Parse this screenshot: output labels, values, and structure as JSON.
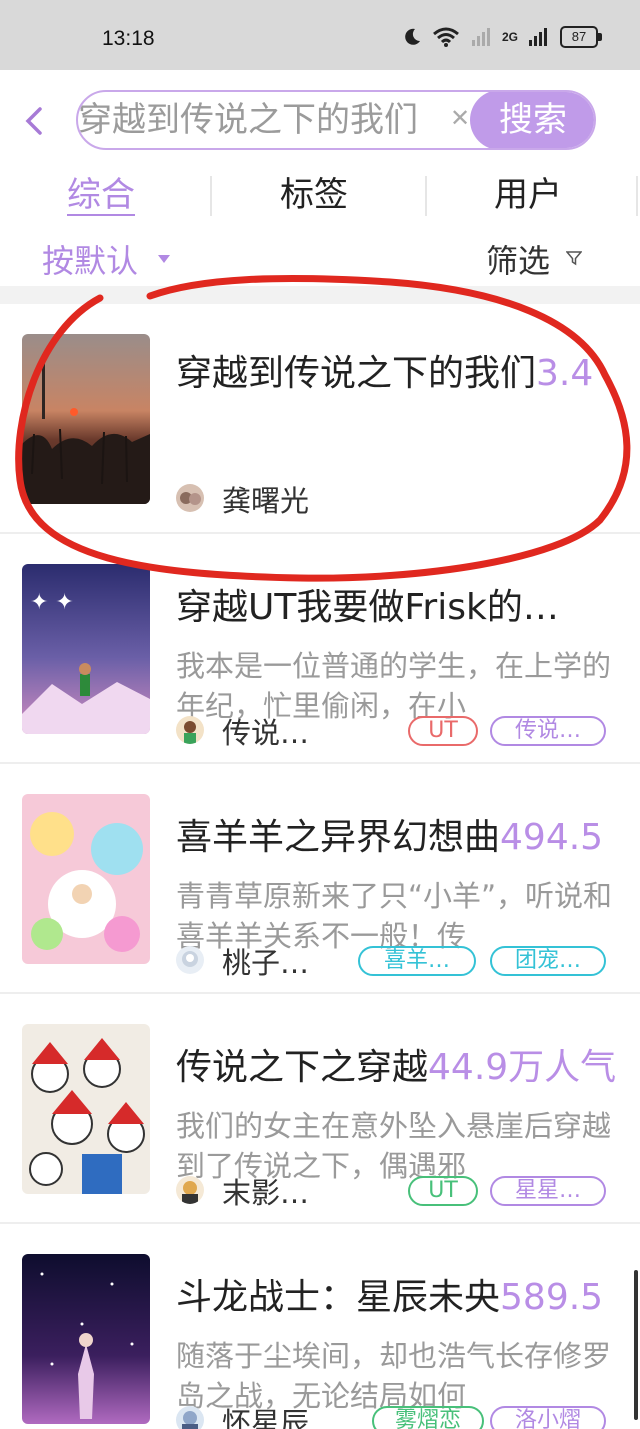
{
  "status_bar": {
    "time": "13:18",
    "battery": "87",
    "network": "2G"
  },
  "search": {
    "query": "穿越到传说之下的我们",
    "button_label": "搜索"
  },
  "tabs": [
    {
      "label": "综合",
      "active": true
    },
    {
      "label": "标签",
      "active": false
    },
    {
      "label": "用户",
      "active": false
    }
  ],
  "filters": {
    "sort_label": "按默认",
    "filter_label": "筛选"
  },
  "results": [
    {
      "title": "穿越到传说之下的我们",
      "title_extra": "3.4",
      "description": "",
      "author": "龚曙光",
      "tags": []
    },
    {
      "title": "穿越UT我要做Frisk的…",
      "title_extra": "",
      "description": "我本是一位普通的学生，在上学的年纪，忙里偷闲，在小",
      "author": "传说…",
      "tags": [
        {
          "label": "UT",
          "color": "red"
        },
        {
          "label": "传说…",
          "color": "purple"
        }
      ]
    },
    {
      "title": "喜羊羊之异界幻想曲",
      "title_extra": "494.5",
      "description": "青青草原新来了只“小羊”，听说和喜羊羊关系不一般！传",
      "author": "桃子…",
      "tags": [
        {
          "label": "喜羊…",
          "color": "cyan"
        },
        {
          "label": "团宠…",
          "color": "cyan"
        }
      ]
    },
    {
      "title": "传说之下之穿越",
      "title_extra": "44.9万人气",
      "description": "我们的女主在意外坠入悬崖后穿越到了传说之下，偶遇邪",
      "author": "末影…",
      "tags": [
        {
          "label": "UT",
          "color": "green"
        },
        {
          "label": "星星…",
          "color": "purple"
        }
      ]
    },
    {
      "title": "斗龙战士：星辰未央",
      "title_extra": "589.5",
      "description": "随落于尘埃间，却也浩气长存修罗岛之战，无论结局如何",
      "author": "怀星辰",
      "tags": [
        {
          "label": "雾熠恋",
          "color": "green"
        },
        {
          "label": "洛小熠",
          "color": "purple"
        }
      ]
    }
  ],
  "colors": {
    "accent": "#b189e3",
    "annotation_red": "#e0281f"
  }
}
